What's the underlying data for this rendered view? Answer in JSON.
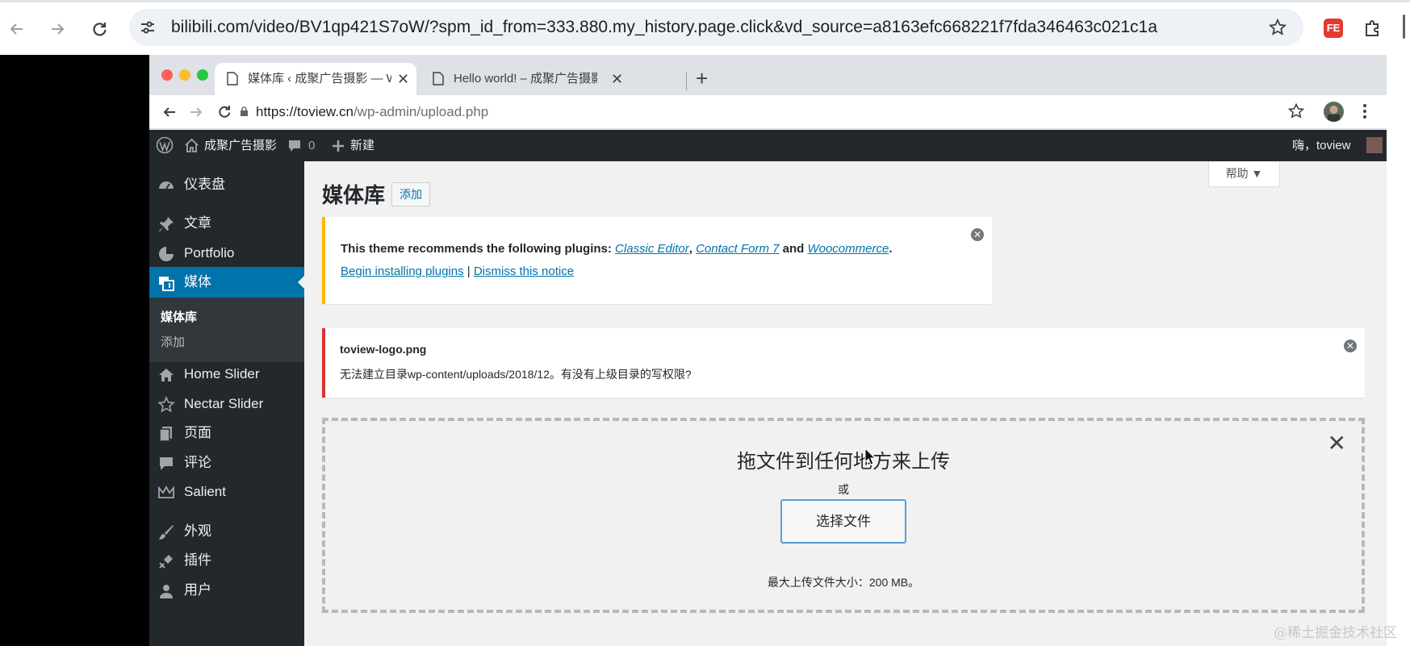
{
  "outer_browser": {
    "url": "bilibili.com/video/BV1qp421S7oW/?spm_id_from=333.880.my_history.page.click&vd_source=a8163efc668221f7fda346463c021c1a",
    "ext_label": "FE"
  },
  "inner_browser": {
    "tabs": [
      {
        "title": "媒体库 ‹ 成聚广告摄影 — Word",
        "active": true
      },
      {
        "title": "Hello world! – 成聚广告摄影",
        "active": false
      }
    ],
    "new_tab": "+",
    "url_host": "https://toview.cn",
    "url_path": "/wp-admin/upload.php"
  },
  "admin_bar": {
    "site_name": "成聚广告摄影",
    "comment_count": "0",
    "new_label": "新建",
    "greeting": "嗨，toview"
  },
  "sidebar": {
    "items": [
      {
        "label": "仪表盘",
        "icon": "dashboard-icon"
      },
      {
        "label": "文章",
        "icon": "pin-icon"
      },
      {
        "label": "Portfolio",
        "icon": "portfolio-icon"
      },
      {
        "label": "媒体",
        "icon": "media-icon",
        "active": true
      },
      {
        "label": "Home Slider",
        "icon": "home-icon"
      },
      {
        "label": "Nectar Slider",
        "icon": "star-icon"
      },
      {
        "label": "页面",
        "icon": "page-icon"
      },
      {
        "label": "评论",
        "icon": "comment-icon"
      },
      {
        "label": "Salient",
        "icon": "crown-icon"
      },
      {
        "label": "外观",
        "icon": "brush-icon"
      },
      {
        "label": "插件",
        "icon": "plugin-icon"
      },
      {
        "label": "用户",
        "icon": "user-icon"
      }
    ],
    "submenu": [
      {
        "label": "媒体库",
        "current": true
      },
      {
        "label": "添加",
        "current": false
      }
    ]
  },
  "main": {
    "help": "帮助 ▼",
    "title": "媒体库",
    "add_new": "添加",
    "plugin_notice": {
      "prefix": "This theme recommends the following plugins: ",
      "plugin1": "Classic Editor",
      "sep1": ", ",
      "plugin2": "Contact Form 7",
      "sep2": " and ",
      "plugin3": "Woocommerce",
      "suffix": ".",
      "install_link": "Begin installing plugins",
      "divider": " | ",
      "dismiss_link": "Dismiss this notice"
    },
    "error_notice": {
      "filename": "toview-logo.png",
      "message": "无法建立目录wp-content/uploads/2018/12。有没有上级目录的写权限?"
    },
    "uploader": {
      "drop_text": "拖文件到任何地方来上传",
      "or_text": "或",
      "select_button": "选择文件",
      "max_size": "最大上传文件大小：200 MB。"
    }
  },
  "watermark": "@稀土掘金技术社区"
}
